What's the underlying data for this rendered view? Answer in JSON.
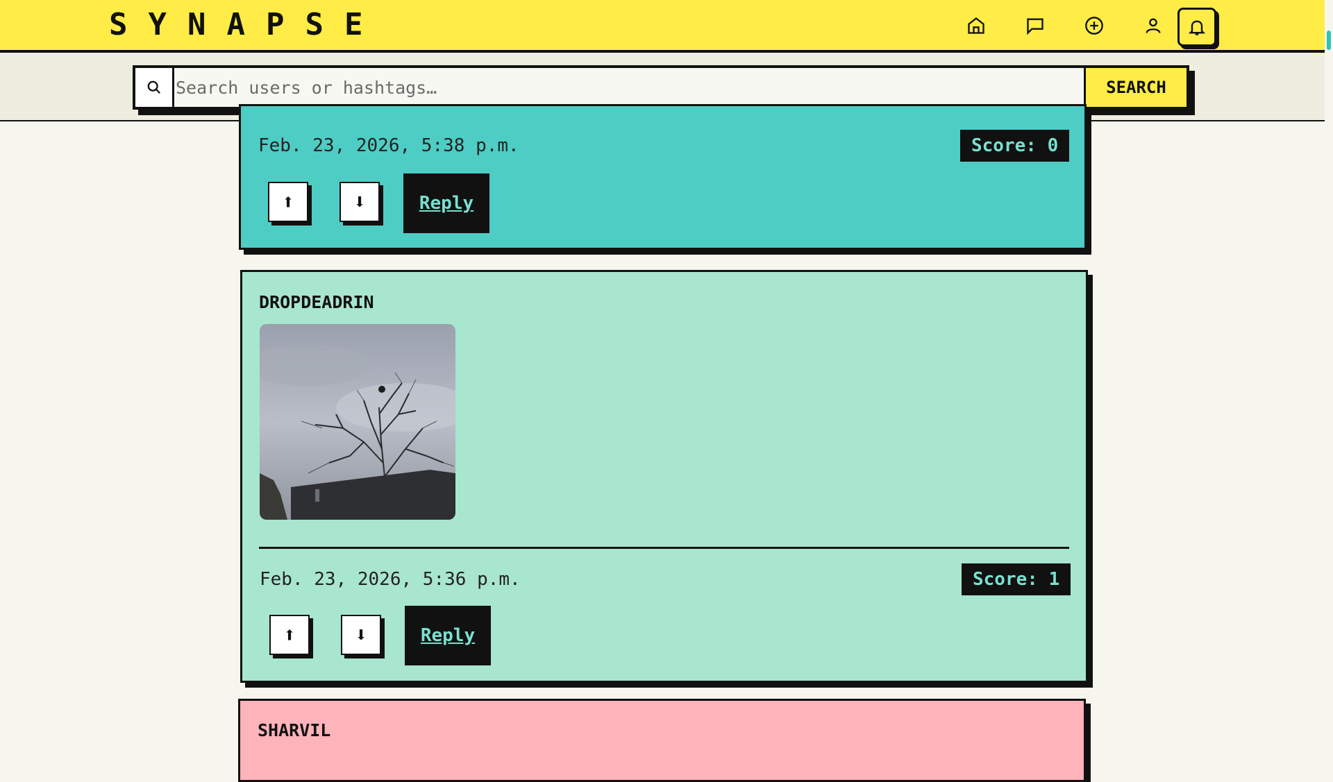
{
  "brand": "SYNAPSE",
  "nav": {
    "icons": [
      "home-icon",
      "chat-icon",
      "plus-circle-icon",
      "user-icon",
      "bell-icon"
    ]
  },
  "search": {
    "placeholder": "Search users or hashtags…",
    "button_label": "SEARCH"
  },
  "comments": [
    {
      "timestamp": "Feb. 23, 2026, 5:38 p.m.",
      "score": "Score: 0",
      "upvote": "⬆",
      "downvote": "⬇",
      "reply": "Reply"
    },
    {
      "username": "DROPDEADRIN",
      "image": "tree-photo",
      "timestamp": "Feb. 23, 2026, 5:36 p.m.",
      "score": "Score: 1",
      "upvote": "⬆",
      "downvote": "⬇",
      "reply": "Reply"
    },
    {
      "username": "SHARVIL"
    }
  ],
  "colors": {
    "header": "#ffec47",
    "card_teal": "#4ecdc4",
    "card_mint": "#a8e6cf",
    "card_pink": "#ffb3ba",
    "score_text": "#79e0d0"
  }
}
